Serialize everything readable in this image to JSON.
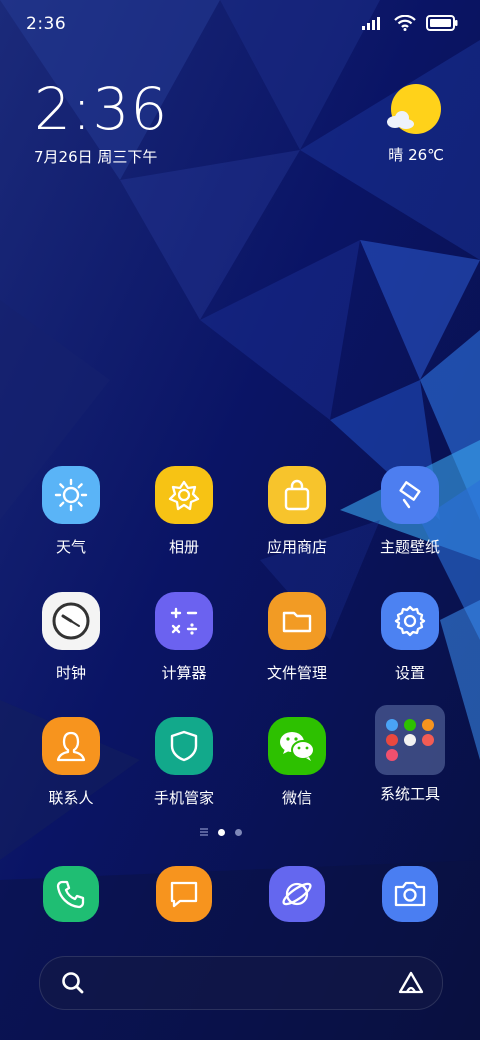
{
  "status_bar": {
    "time": "2:36",
    "icons": [
      "signal-icon",
      "wifi-icon",
      "battery-icon"
    ]
  },
  "clock_widget": {
    "time": "2:36",
    "date": "7月26日 周三下午"
  },
  "weather_widget": {
    "condition": "晴",
    "temperature": "26℃",
    "icon": "sun-cloud-icon",
    "text": "晴 26℃"
  },
  "apps": [
    {
      "name": "天气",
      "icon": "sun-icon",
      "color": "#5ab4f7"
    },
    {
      "name": "相册",
      "icon": "flower-icon",
      "color": "#f7c314"
    },
    {
      "name": "应用商店",
      "icon": "shopping-bag-icon",
      "color": "#f7c42c"
    },
    {
      "name": "主题壁纸",
      "icon": "paintbrush-icon",
      "color": "#4d7ef0"
    },
    {
      "name": "时钟",
      "icon": "clock-icon",
      "color": "#f4f4f4"
    },
    {
      "name": "计算器",
      "icon": "calculator-icon",
      "color": "#6b62f0"
    },
    {
      "name": "文件管理",
      "icon": "folder-icon",
      "color": "#f29b24"
    },
    {
      "name": "设置",
      "icon": "gear-icon",
      "color": "#4c82f2"
    },
    {
      "name": "联系人",
      "icon": "person-icon",
      "color": "#f7941e"
    },
    {
      "name": "手机管家",
      "icon": "shield-icon",
      "color": "#12a98b"
    },
    {
      "name": "微信",
      "icon": "wechat-icon",
      "color": "#2dc100"
    },
    {
      "name": "系统工具",
      "icon": "folder-group-icon",
      "color": "#3a4a7a"
    }
  ],
  "page_indicator": {
    "pages": 2,
    "current": 1
  },
  "dock": [
    {
      "name": "phone",
      "icon": "phone-icon",
      "color": "#1fbe73"
    },
    {
      "name": "messages",
      "icon": "message-icon",
      "color": "#f7941e"
    },
    {
      "name": "browser",
      "icon": "planet-icon",
      "color": "#6467ef"
    },
    {
      "name": "camera",
      "icon": "camera-icon",
      "color": "#4a7ef2"
    }
  ],
  "search_bar": {
    "left_icon": "search-icon",
    "right_icon": "assistant-icon"
  }
}
